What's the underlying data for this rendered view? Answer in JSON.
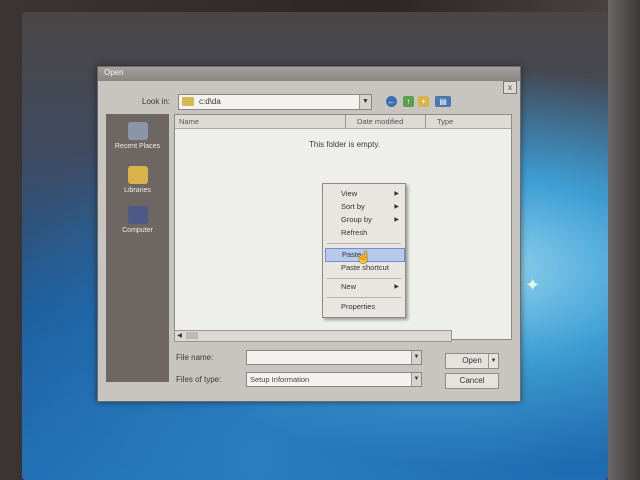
{
  "dialog": {
    "title": "Open",
    "look_in_label": "Look in:",
    "look_in_value": "c:d\\da",
    "empty_message": "This folder is empty.",
    "close_glyph": "x"
  },
  "places": [
    {
      "label": "Recent Places"
    },
    {
      "label": "Libraries"
    },
    {
      "label": "Computer"
    }
  ],
  "columns": [
    "Name",
    "Date modified",
    "Type"
  ],
  "file_name": {
    "label": "File name:",
    "value": ""
  },
  "file_type": {
    "label": "Files of type:",
    "value": "Setup Information"
  },
  "buttons": {
    "open": "Open",
    "cancel": "Cancel"
  },
  "context_menu": {
    "items": [
      "View",
      "Sort by",
      "Group by",
      "Refresh",
      "Paste",
      "Paste shortcut",
      "New",
      "Properties"
    ],
    "highlighted": "Paste"
  },
  "colors": {
    "menu_highlight": "#b9c9ec",
    "places_bar": "#6e6662",
    "dialog_face": "#c8c4c0"
  }
}
